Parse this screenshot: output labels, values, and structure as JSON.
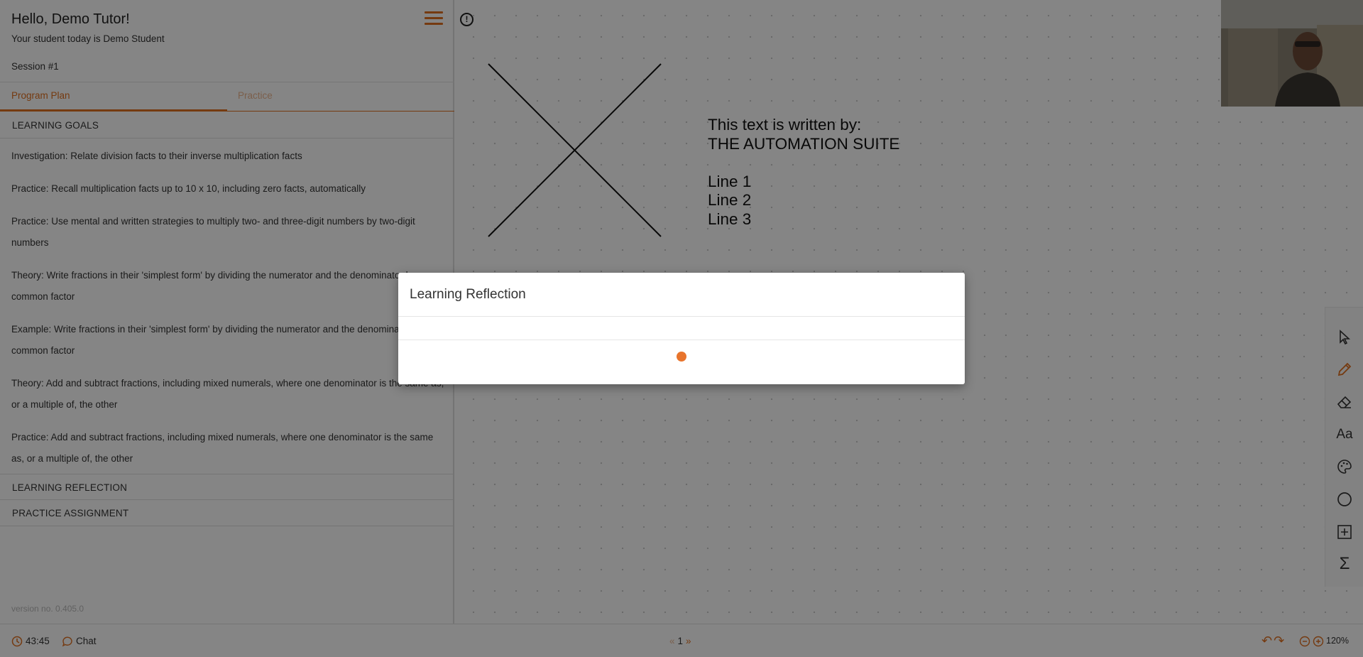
{
  "sidebar": {
    "greeting": "Hello, Demo Tutor!",
    "student": "Your student today is Demo Student",
    "session": "Session #1",
    "tabs": [
      {
        "label": "Program Plan",
        "active": true
      },
      {
        "label": "Practice",
        "active": false
      }
    ],
    "sections": {
      "learning_goals": "LEARNING GOALS",
      "learning_reflection": "LEARNING REFLECTION",
      "practice_assignment": "PRACTICE ASSIGNMENT"
    },
    "goals": [
      "Investigation: Relate division facts to their inverse multiplication facts",
      "Practice: Recall multiplication facts up to 10 x 10, including zero facts, automatically",
      "Practice: Use mental and written strategies to multiply two- and three-digit numbers by two-digit numbers",
      "Theory: Write fractions in their 'simplest form' by dividing the numerator and the denominator by a common factor",
      "Example: Write fractions in their 'simplest form' by dividing the numerator and the denominator by a common factor",
      "Theory: Add and subtract fractions, including mixed numerals, where one denominator is the same as, or a multiple of, the other",
      "Practice: Add and subtract fractions, including mixed numerals, where one denominator is the same as, or a multiple of, the other"
    ],
    "version": "version no. 0.405.0"
  },
  "canvas": {
    "text_lines": [
      "This text is written by:",
      "THE AUTOMATION SUITE",
      "",
      "Line 1",
      "Line 2",
      "Line 3"
    ]
  },
  "toolbar": {
    "tools": [
      "cursor-icon",
      "pencil-icon",
      "eraser-icon",
      "text-icon",
      "palette-icon",
      "circle-icon",
      "add-box-icon",
      "sigma-icon"
    ],
    "text_tool_label": "Aa",
    "sigma_label": "Σ",
    "active_tool": "pencil-icon"
  },
  "bottombar": {
    "timer": "43:45",
    "chat_label": "Chat",
    "page_number": "1",
    "zoom": "120%"
  },
  "modal": {
    "title": "Learning Reflection"
  },
  "colors": {
    "accent": "#e07020",
    "overlay": "rgba(0,0,0,0.48)"
  }
}
